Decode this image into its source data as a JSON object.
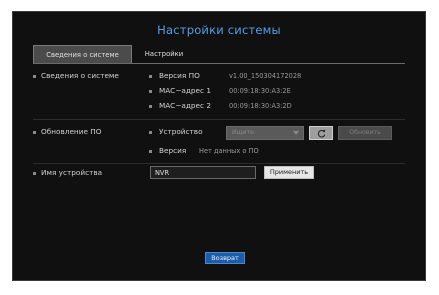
{
  "window": {
    "title": "Настройки системы"
  },
  "tabs": [
    {
      "label": "Сведения о системе",
      "active": true
    },
    {
      "label": "Настройки",
      "active": false
    }
  ],
  "system_info": {
    "section_label": "Сведения о системе",
    "rows": [
      {
        "label": "Версия ПО",
        "value": "v1.00_150304172028"
      },
      {
        "label": "MAC−адрес 1",
        "value": "00:09:18:30:A3:2E"
      },
      {
        "label": "MAC−адрес 2",
        "value": "00:09:18:30:A3:2D"
      }
    ]
  },
  "firmware": {
    "section_label": "Обновление ПО",
    "device_label": "Устройство",
    "device_placeholder": "Ищите",
    "update_button": "Обновить",
    "version_label": "Версия",
    "version_value": "Нет данных о ПО"
  },
  "device_name": {
    "section_label": "Имя устройства",
    "value": "NVR",
    "apply_button": "Применить"
  },
  "footer": {
    "back_button": "Возврат"
  },
  "colors": {
    "accent": "#5a9ee8",
    "back_button": "#1d5da7",
    "background": "#101010"
  }
}
